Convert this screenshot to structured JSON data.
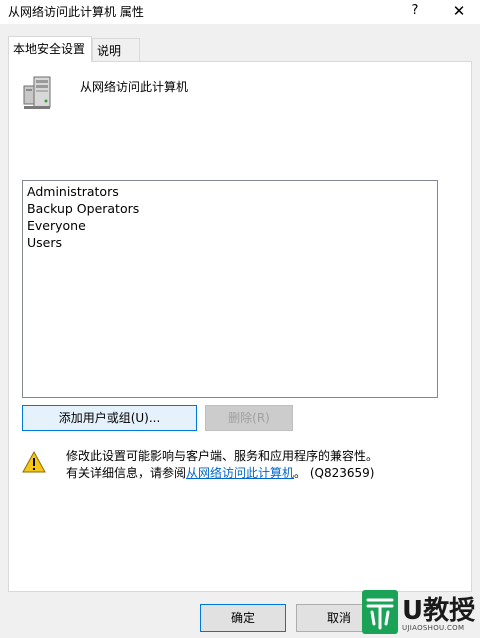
{
  "window": {
    "title": "从网络访问此计算机 属性",
    "help_label": "?",
    "close_label": "✕"
  },
  "tabs": [
    {
      "label": "本地安全设置",
      "active": true
    },
    {
      "label": "说明",
      "active": false
    }
  ],
  "policy": {
    "name": "从网络访问此计算机",
    "icon": "server-icon"
  },
  "members": [
    "Administrators",
    "Backup Operators",
    "Everyone",
    "Users"
  ],
  "buttons": {
    "add": "添加用户或组(U)...",
    "remove": "删除(R)",
    "ok": "确定",
    "cancel": "取消"
  },
  "warning": {
    "icon": "warning-icon",
    "line1": "修改此设置可能影响与客户端、服务和应用程序的兼容性。",
    "line2_prefix": "有关详细信息，请参阅",
    "line2_link": "从网络访问此计算机",
    "line2_suffix": "。 (Q823659)"
  },
  "watermark": {
    "brand_big": "U教授",
    "brand_small": "UJIAOSHOU.COM"
  },
  "colors": {
    "accent": "#0078d7",
    "link": "#0066cc",
    "watermark_green": "#1aa256"
  }
}
